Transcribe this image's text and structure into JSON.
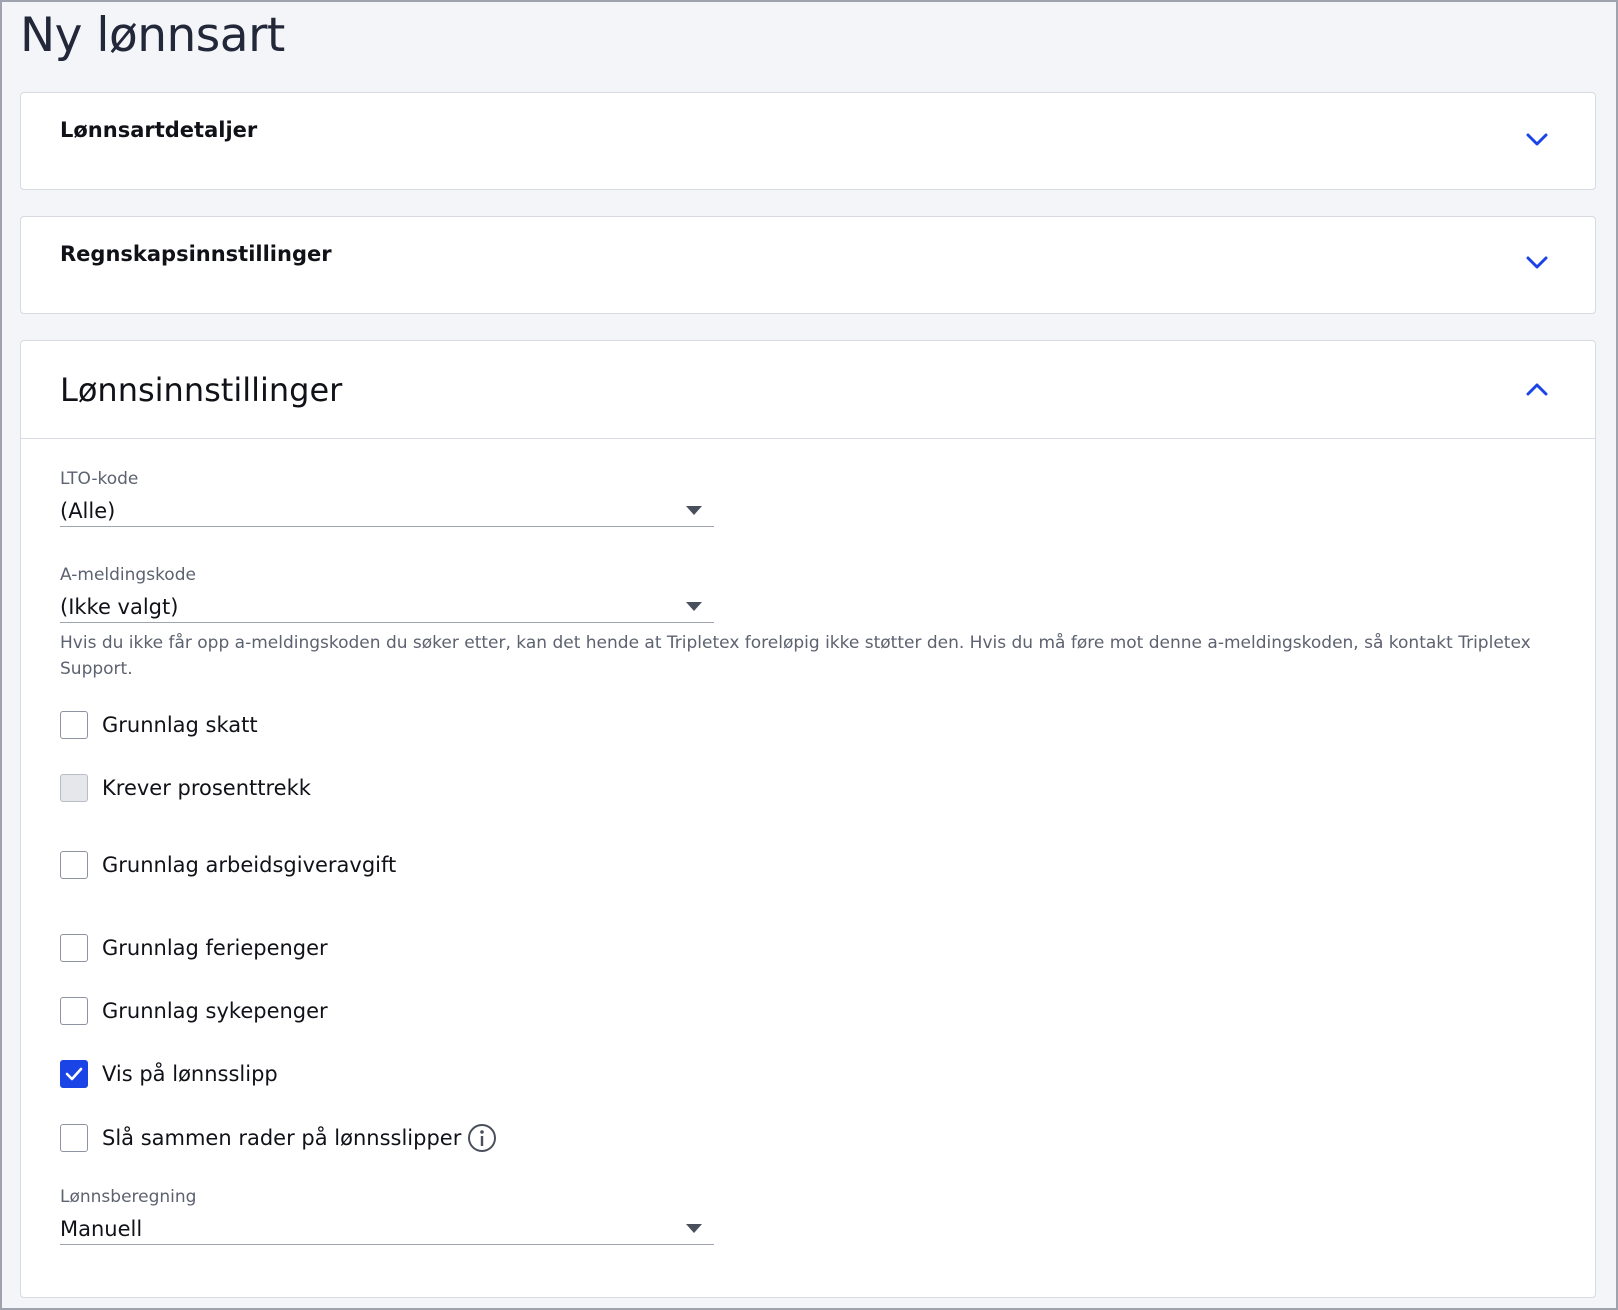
{
  "page": {
    "title": "Ny lønnsart"
  },
  "sections": {
    "details": {
      "title": "Lønnsartdetaljer",
      "expanded": false
    },
    "accounting": {
      "title": "Regnskapsinnstillinger",
      "expanded": false
    },
    "payroll": {
      "title": "Lønnsinnstillinger",
      "expanded": true
    }
  },
  "payroll": {
    "lto": {
      "label": "LTO-kode",
      "value": "(Alle)"
    },
    "ameld": {
      "label": "A-meldingskode",
      "value": "(Ikke valgt)"
    },
    "help": "Hvis du ikke får opp a-meldingskoden du søker etter, kan det hende at Tripletex foreløpig ikke støtter den. Hvis du må føre mot denne a-meldingskoden, så kontakt Tripletex Support.",
    "checks": [
      {
        "label": "Grunnlag skatt",
        "checked": false,
        "disabled": false
      },
      {
        "label": "Krever prosenttrekk",
        "checked": false,
        "disabled": true
      },
      {
        "label": "Grunnlag arbeidsgiveravgift",
        "checked": false,
        "disabled": false
      },
      {
        "label": "Grunnlag feriepenger",
        "checked": false,
        "disabled": false
      },
      {
        "label": "Grunnlag sykepenger",
        "checked": false,
        "disabled": false
      },
      {
        "label": "Vis på lønnsslipp",
        "checked": true,
        "disabled": false
      },
      {
        "label": "Slå sammen rader på lønnsslipper",
        "checked": false,
        "disabled": false
      }
    ],
    "calc": {
      "label": "Lønnsberegning",
      "value": "Manuell"
    }
  },
  "colors": {
    "accent": "#1b44e6",
    "border": "#d7dae1",
    "text": "#101218",
    "muted": "#5d6270"
  },
  "icons": {
    "collapsed": "chevron-down-icon",
    "expanded": "chevron-up-icon",
    "dropdown": "caret-down-icon",
    "info": "info-icon",
    "check": "checkmark-icon"
  }
}
